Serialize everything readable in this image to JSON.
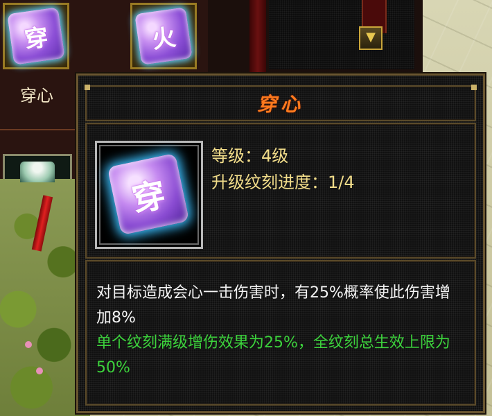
{
  "inventory": {
    "slots": [
      {
        "glyph": "穿",
        "label": "穿心"
      },
      {
        "glyph": "火"
      }
    ]
  },
  "list_panel": {
    "scroll_down_icon": "chevron-down-icon"
  },
  "tooltip": {
    "title": "穿心",
    "icon_glyph": "穿",
    "level_label": "等级：",
    "level_value": "4级",
    "progress_label": "升级纹刻进度：",
    "progress_value": "1/4",
    "description_white": "对目标造成会心一击伤害时，有25%概率使此伤害增加8%",
    "description_green": "单个纹刻满级增伤效果为25%，全纹刻总生效上限为50%"
  },
  "colors": {
    "title": "#ff7a1e",
    "stat_text": "#f2dd8a",
    "desc_white": "#f4f4f4",
    "desc_green": "#3cd23c",
    "frame_gold": "#9a7a22"
  }
}
